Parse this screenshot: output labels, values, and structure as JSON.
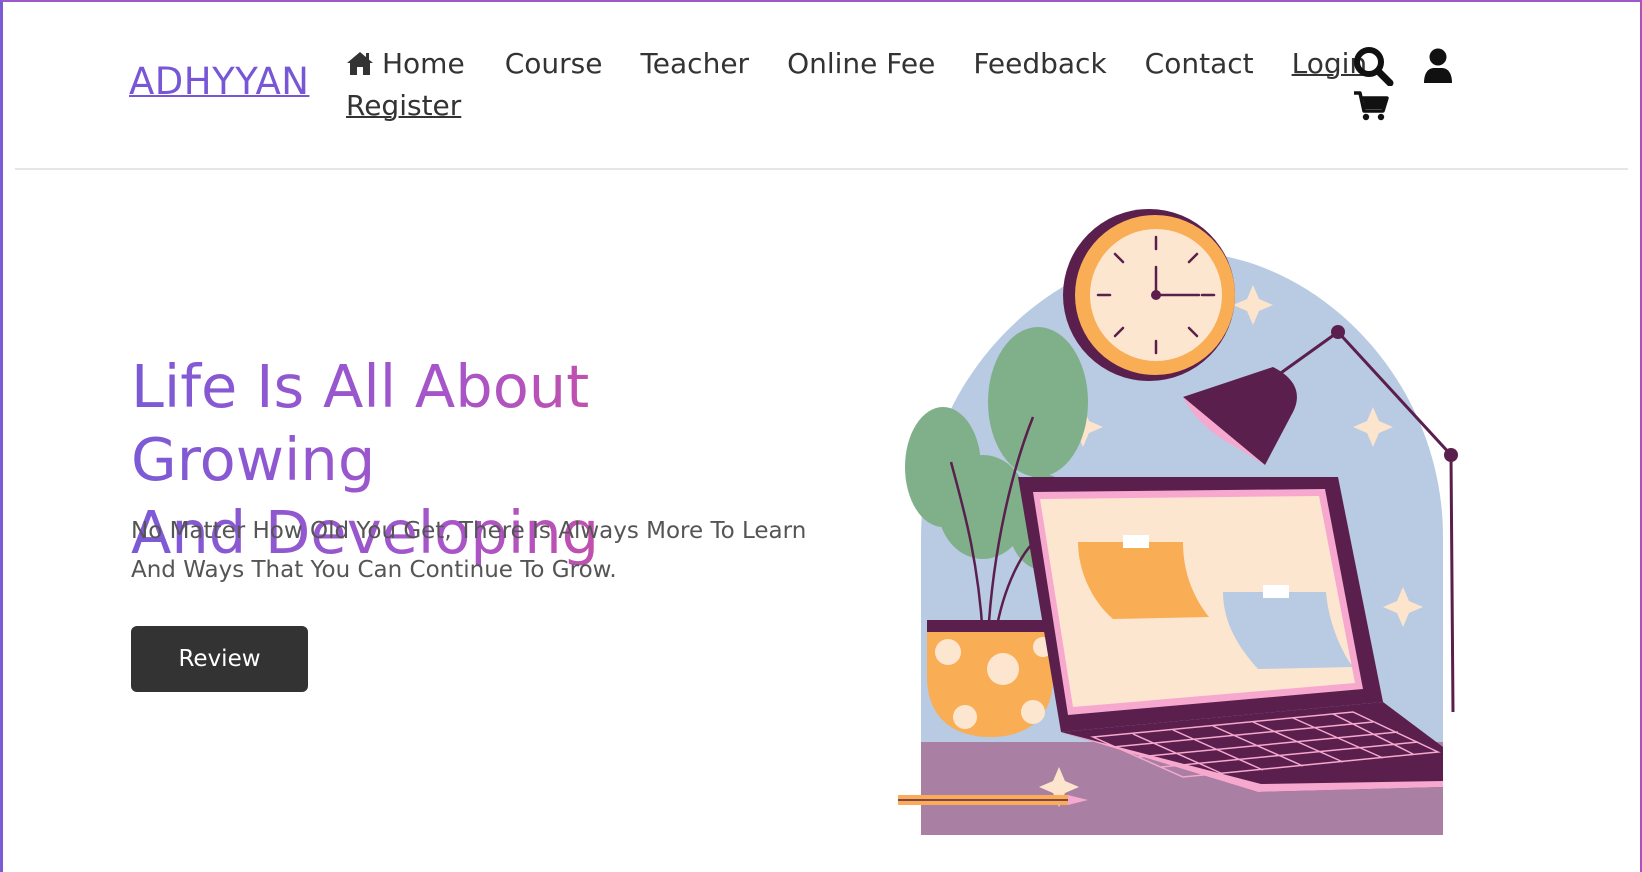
{
  "header": {
    "logo": "ADHYYAN",
    "nav": [
      {
        "label": "Home",
        "icon": "home-icon"
      },
      {
        "label": "Course"
      },
      {
        "label": "Teacher"
      },
      {
        "label": "Online Fee"
      },
      {
        "label": "Feedback"
      },
      {
        "label": "Contact"
      },
      {
        "label": "Login"
      },
      {
        "label": "Register"
      }
    ],
    "icons": [
      "search-icon",
      "user-icon",
      "cart-icon"
    ]
  },
  "hero": {
    "title_line1": "Life Is All About Growing",
    "title_line2": "And Developing",
    "subtitle_line1": "No Matter How Old You Get, There Is Always More To Learn",
    "subtitle_line2": "And Ways That You Can Continue To Grow.",
    "button": "Review"
  },
  "colors": {
    "brand": "#7757d6",
    "gradient_end": "#e24a88",
    "button_bg": "#333333",
    "text_dark": "#333333"
  }
}
